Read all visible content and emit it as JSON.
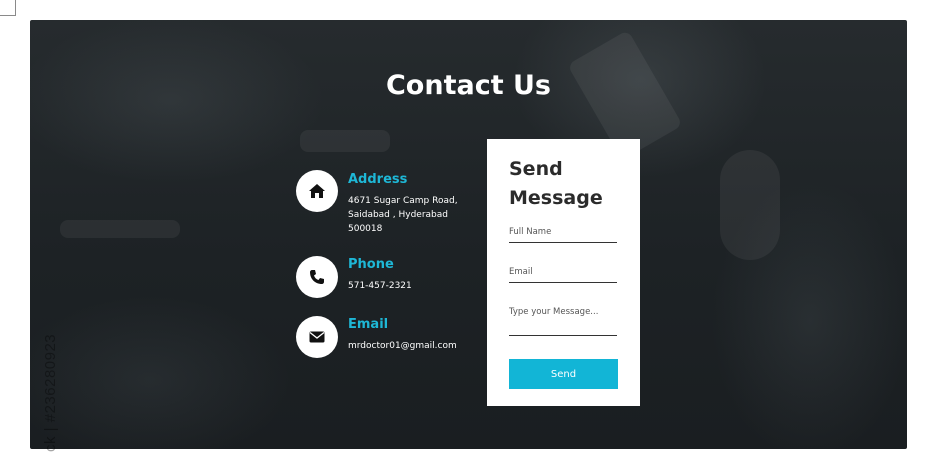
{
  "page_title": "Contact Us",
  "contact_info": {
    "address": {
      "heading": "Address",
      "text": "4671 Sugar Camp Road,\nSaidabad , Hyderabad\n500018",
      "icon": "home-icon"
    },
    "phone": {
      "heading": "Phone",
      "text": "571-457-2321",
      "icon": "phone-icon"
    },
    "email": {
      "heading": "Email",
      "text": "mrdoctor01@gmail.com",
      "icon": "envelope-icon"
    }
  },
  "form": {
    "title": "Send Message",
    "full_name_placeholder": "Full Name",
    "email_placeholder": "Email",
    "message_placeholder": "Type your Message...",
    "send_label": "Send"
  },
  "watermark": "ck | #236280923",
  "colors": {
    "accent": "#12b5d6",
    "heading_accent": "#1eb7d6",
    "background": "#1f2427",
    "card": "#ffffff"
  }
}
